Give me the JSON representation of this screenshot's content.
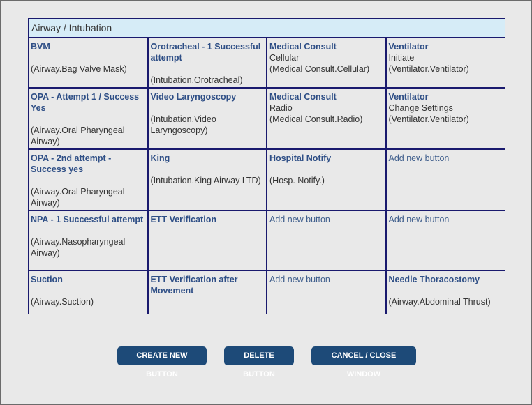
{
  "panel": {
    "title": "Airway / Intubation"
  },
  "grid": {
    "rows": [
      [
        {
          "title": "BVM",
          "sub": "",
          "code": "(Airway.Bag Valve Mask)"
        },
        {
          "title": "Orotracheal - 1 Successful attempt",
          "sub": "",
          "code": "(Intubation.Orotracheal)"
        },
        {
          "title": "Medical Consult",
          "sub": "Cellular",
          "code": "(Medical Consult.Cellular)"
        },
        {
          "title": "Ventilator",
          "sub": "Initiate",
          "code": "(Ventilator.Ventilator)"
        }
      ],
      [
        {
          "title": "OPA - Attempt 1 / Success Yes",
          "sub": "",
          "code": "(Airway.Oral Pharyngeal Airway)"
        },
        {
          "title": "Video Laryngoscopy",
          "sub": "",
          "code": "(Intubation.Video Laryngoscopy)"
        },
        {
          "title": "Medical Consult",
          "sub": "Radio",
          "code": "(Medical Consult.Radio)"
        },
        {
          "title": "Ventilator",
          "sub": "Change Settings",
          "code": "(Ventilator.Ventilator)"
        }
      ],
      [
        {
          "title": "OPA - 2nd attempt - Success yes",
          "sub": "",
          "code": "(Airway.Oral Pharyngeal Airway)"
        },
        {
          "title": "King",
          "sub": "",
          "code": "(Intubation.King Airway LTD)"
        },
        {
          "title": "Hospital Notify",
          "sub": "",
          "code": "(Hosp. Notify.)"
        },
        {
          "add": "Add new button"
        }
      ],
      [
        {
          "title": "NPA - 1 Successful attempt",
          "sub": "",
          "code": "(Airway.Nasopharyngeal Airway)"
        },
        {
          "title": "ETT Verification",
          "sub": "",
          "code": ""
        },
        {
          "add": "Add new button"
        },
        {
          "add": "Add new button"
        }
      ],
      [
        {
          "title": "Suction",
          "sub": "",
          "code": "(Airway.Suction)"
        },
        {
          "title": "ETT Verification after Movement",
          "sub": "",
          "code": ""
        },
        {
          "add": "Add new button"
        },
        {
          "title": "Needle Thoracostomy",
          "sub": "",
          "code": "(Airway.Abdominal Thrust)"
        }
      ]
    ]
  },
  "actions": {
    "create": "CREATE NEW BUTTON",
    "delete": "DELETE BUTTON",
    "cancel": "CANCEL / CLOSE WINDOW"
  }
}
